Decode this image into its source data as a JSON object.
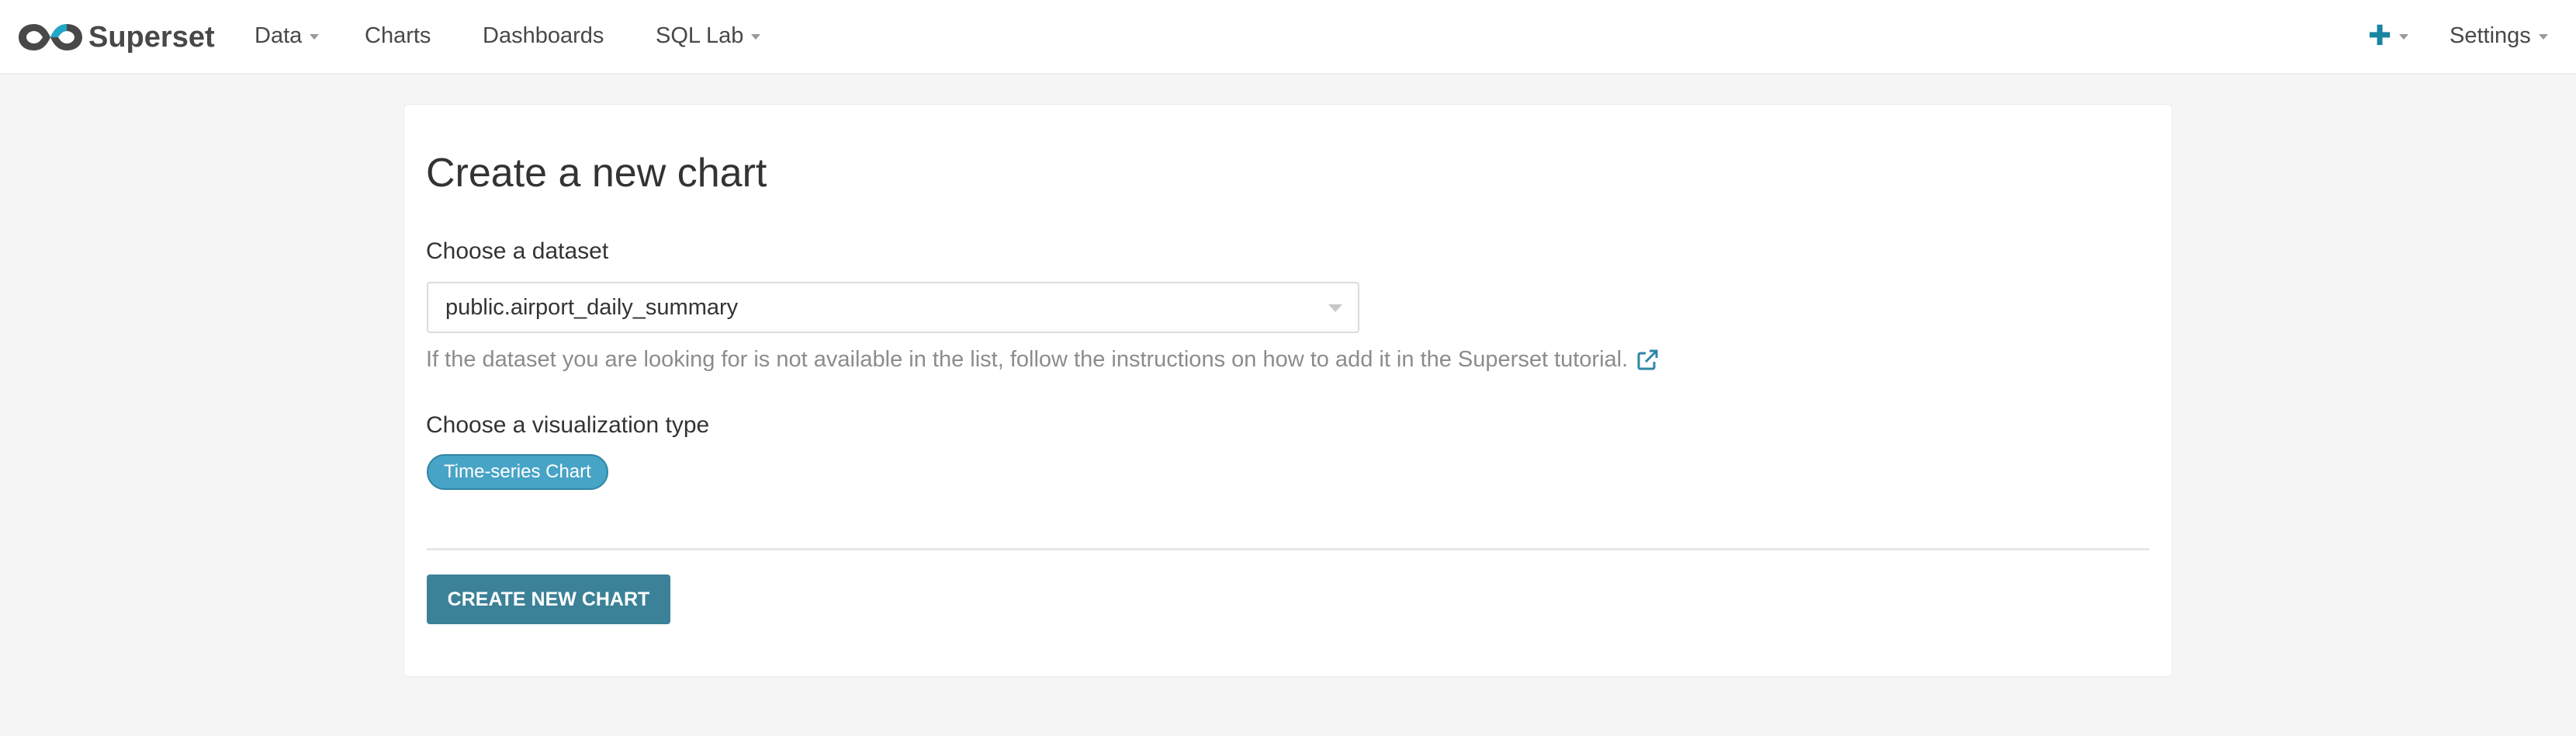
{
  "brand": {
    "name": "Superset",
    "logo_icon": "superset-infinity-logo"
  },
  "navbar": {
    "items": [
      {
        "label": "Data",
        "has_dropdown": true
      },
      {
        "label": "Charts",
        "has_dropdown": false
      },
      {
        "label": "Dashboards",
        "has_dropdown": false
      },
      {
        "label": "SQL Lab",
        "has_dropdown": true
      }
    ],
    "right": {
      "add_icon": "plus-icon",
      "settings_label": "Settings"
    }
  },
  "page": {
    "title": "Create a new chart",
    "dataset_label": "Choose a dataset",
    "dataset_value": "public.airport_daily_summary",
    "help_text": "If the dataset you are looking for is not available in the list, follow the instructions on how to add it in the Superset tutorial.",
    "viz_label": "Choose a visualization type",
    "viz_type": "Time-series Chart",
    "create_button": "CREATE NEW CHART"
  },
  "colors": {
    "accent": "#1a85a0",
    "button": "#3b8198",
    "tag": "#48a4c6",
    "background": "#f5f5f5",
    "help_text": "#8c8c8c"
  }
}
